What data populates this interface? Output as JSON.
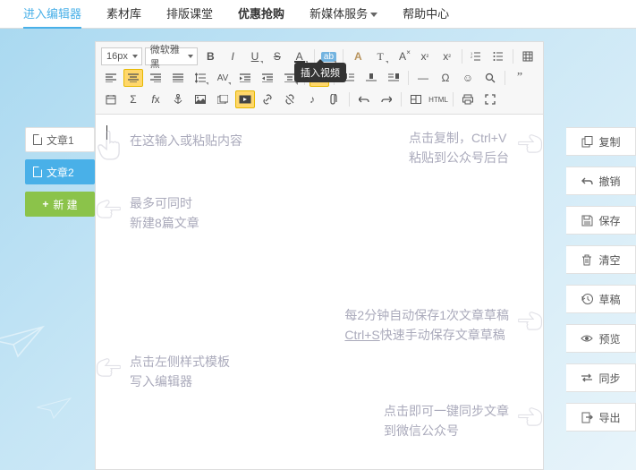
{
  "topnav": {
    "items": [
      {
        "label": "进入编辑器",
        "active": true
      },
      {
        "label": "素材库"
      },
      {
        "label": "排版课堂"
      },
      {
        "label": "优惠抢购",
        "bold": true
      },
      {
        "label": "新媒体服务",
        "dropdown": true
      },
      {
        "label": "帮助中心"
      }
    ]
  },
  "tooltip_text": "插入视频",
  "font_size": "16px",
  "font_family": "微软雅黑",
  "left_tabs": {
    "tab1": "文章1",
    "tab2": "文章2",
    "new": "新 建"
  },
  "hints": {
    "type_here": "在这输入或粘贴内容",
    "copy_line1": "点击复制，Ctrl+V",
    "copy_line2": "粘贴到公众号后台",
    "max_line1": "最多可同时",
    "max_line2": "新建8篇文章",
    "autosave_line1": "每2分钟自动保存1次文章草稿",
    "autosave_line2_a": "Ctrl+S",
    "autosave_line2_b": "快速手动保存文章草稿",
    "template_line1": "点击左侧样式模板",
    "template_line2": "写入编辑器",
    "sync_line1": "点击即可一键同步文章",
    "sync_line2": "到微信公众号"
  },
  "actions": {
    "copy": "复制",
    "undo": "撤销",
    "save": "保存",
    "clear": "清空",
    "draft": "草稿",
    "preview": "预览",
    "sync": "同步",
    "export": "导出"
  }
}
